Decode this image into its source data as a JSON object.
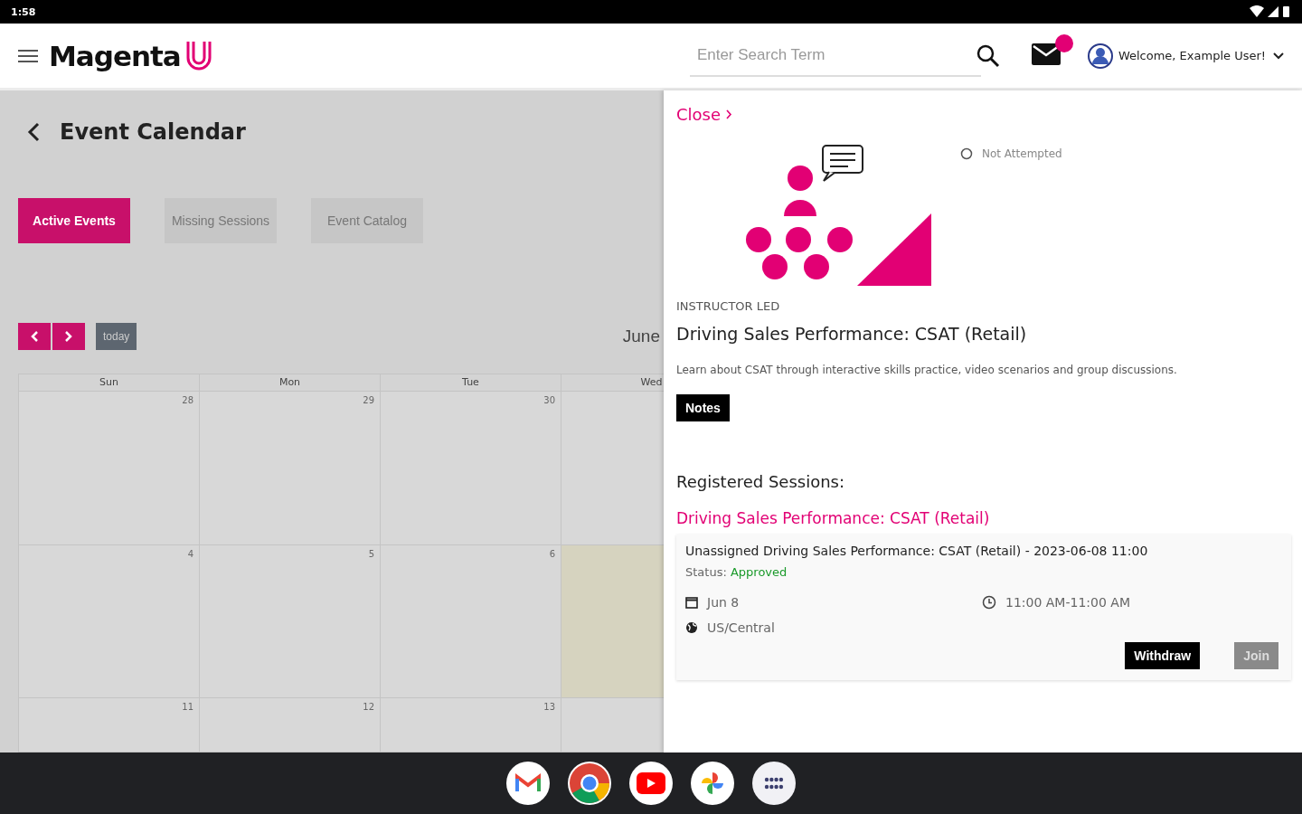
{
  "status_bar": {
    "time": "1:58"
  },
  "header": {
    "logo": "Magenta",
    "search": {
      "placeholder": "Enter Search Term"
    },
    "user": "Welcome, Example User!"
  },
  "page": {
    "title": "Event Calendar",
    "tabs": [
      {
        "label": "Active Events",
        "selected": true
      },
      {
        "label": "Missing Sessions",
        "selected": false
      },
      {
        "label": "Event Catalog",
        "selected": false
      }
    ],
    "calendar": {
      "today_button": "today",
      "month": "June",
      "columns": [
        "Sun",
        "Mon",
        "Tue",
        "Wed"
      ],
      "weeks": [
        [
          {
            "day": "28",
            "today": false
          },
          {
            "day": "29",
            "today": false
          },
          {
            "day": "30",
            "today": false
          },
          {
            "today": false
          }
        ],
        [
          {
            "day": "4",
            "today": false
          },
          {
            "day": "5",
            "today": false
          },
          {
            "day": "6",
            "today": false
          },
          {
            "today": true
          }
        ],
        [
          {
            "day": "11",
            "today": false
          },
          {
            "day": "12",
            "today": false
          },
          {
            "day": "13",
            "today": false
          },
          {
            "today": false
          }
        ]
      ]
    }
  },
  "panel": {
    "close": "Close",
    "status": "Not Attempted",
    "category": "INSTRUCTOR LED",
    "title": "Driving Sales Performance: CSAT (Retail)",
    "description": "Learn about CSAT through interactive skills practice, video scenarios and group discussions.",
    "notes_button": "Notes",
    "sessions_heading": "Registered Sessions:",
    "session_link": "Driving Sales Performance: CSAT (Retail)",
    "sessions": [
      {
        "name": "Unassigned Driving Sales Performance: CSAT (Retail) - 2023-06-08 11:00",
        "status_label": "Status:",
        "status": "Approved",
        "date": "Jun 8",
        "time": "11:00 AM-11:00 AM",
        "timezone": "US/Central",
        "buttons": [
          {
            "label": "Withdraw",
            "disabled": false
          },
          {
            "label": "Join",
            "disabled": true
          }
        ]
      }
    ]
  },
  "dock": [
    {
      "kind": "mail"
    },
    {
      "kind": "browser"
    },
    {
      "kind": "video"
    },
    {
      "kind": "photos"
    },
    {
      "kind": "apps"
    }
  ]
}
